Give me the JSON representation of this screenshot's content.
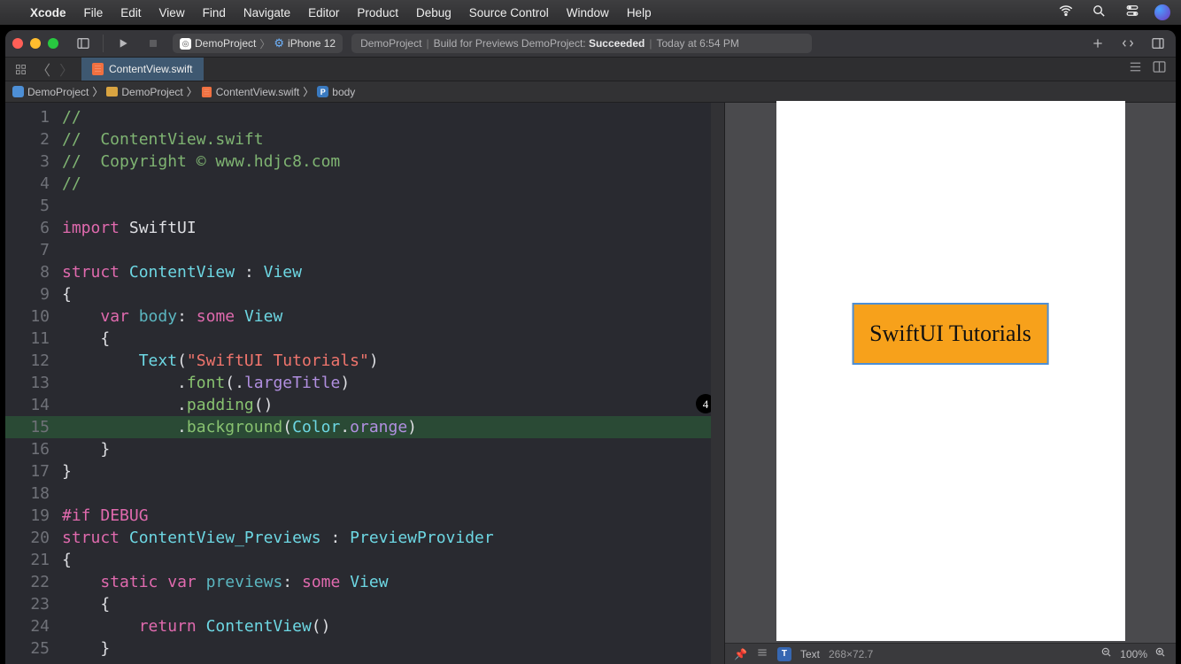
{
  "menubar": {
    "app": "Xcode",
    "items": [
      "File",
      "Edit",
      "View",
      "Find",
      "Navigate",
      "Editor",
      "Product",
      "Debug",
      "Source Control",
      "Window",
      "Help"
    ]
  },
  "toolbar": {
    "scheme_project": "DemoProject",
    "scheme_device": "iPhone 12",
    "activity_prefix": "DemoProject",
    "activity_mid": "Build for Previews DemoProject:",
    "activity_status": "Succeeded",
    "activity_time": "Today at 6:54 PM"
  },
  "tab": {
    "filename": "ContentView.swift"
  },
  "breadcrumbs": [
    {
      "icon": "proj",
      "label": "DemoProject"
    },
    {
      "icon": "fold",
      "label": "DemoProject"
    },
    {
      "icon": "file",
      "label": "ContentView.swift"
    },
    {
      "icon": "prop",
      "label": "body"
    }
  ],
  "code": {
    "lines": [
      {
        "n": 1,
        "html": "<span class='tok-comment'>//</span>"
      },
      {
        "n": 2,
        "html": "<span class='tok-comment'>//  ContentView.swift</span>"
      },
      {
        "n": 3,
        "html": "<span class='tok-comment'>//  Copyright © www.hdjc8.com</span>"
      },
      {
        "n": 4,
        "html": "<span class='tok-comment'>//</span>"
      },
      {
        "n": 5,
        "html": ""
      },
      {
        "n": 6,
        "html": "<span class='tok-keyword'>import</span> <span class='tok-text'>SwiftUI</span>"
      },
      {
        "n": 7,
        "html": ""
      },
      {
        "n": 8,
        "html": "<span class='tok-keyword'>struct</span> <span class='tok-type'>ContentView</span> <span class='tok-text'>:</span> <span class='tok-type'>View</span>"
      },
      {
        "n": 9,
        "html": "<span class='tok-text'>{</span>"
      },
      {
        "n": 10,
        "html": "    <span class='tok-keyword'>var</span> <span class='tok-typealt'>body</span><span class='tok-text'>:</span> <span class='tok-keyword'>some</span> <span class='tok-type'>View</span>"
      },
      {
        "n": 11,
        "html": "    <span class='tok-text'>{</span>"
      },
      {
        "n": 12,
        "html": "        <span class='tok-type'>Text</span><span class='tok-text'>(</span><span class='tok-string'>\"SwiftUI Tutorials\"</span><span class='tok-text'>)</span>"
      },
      {
        "n": 13,
        "html": "            <span class='tok-text'>.</span><span class='tok-func'>font</span><span class='tok-text'>(.</span><span class='tok-enum'>largeTitle</span><span class='tok-text'>)</span>"
      },
      {
        "n": 14,
        "html": "            <span class='tok-text'>.</span><span class='tok-func'>padding</span><span class='tok-text'>()</span>",
        "badge": "4"
      },
      {
        "n": 15,
        "html": "            <span class='tok-text'>.</span><span class='tok-func'>background</span><span class='tok-text'>(</span><span class='tok-type'>Color</span><span class='tok-text'>.</span><span class='tok-enum'>orange</span><span class='tok-text'>)</span>",
        "hl": true
      },
      {
        "n": 16,
        "html": "    <span class='tok-text'>}</span>"
      },
      {
        "n": 17,
        "html": "<span class='tok-text'>}</span>"
      },
      {
        "n": 18,
        "html": ""
      },
      {
        "n": 19,
        "html": "<span class='tok-keyword'>#if</span> <span class='tok-keyword'>DEBUG</span>"
      },
      {
        "n": 20,
        "html": "<span class='tok-keyword'>struct</span> <span class='tok-type'>ContentView_Previews</span> <span class='tok-text'>:</span> <span class='tok-type'>PreviewProvider</span>"
      },
      {
        "n": 21,
        "html": "<span class='tok-text'>{</span>"
      },
      {
        "n": 22,
        "html": "    <span class='tok-keyword'>static</span> <span class='tok-keyword'>var</span> <span class='tok-typealt'>previews</span><span class='tok-text'>:</span> <span class='tok-keyword'>some</span> <span class='tok-type'>View</span>"
      },
      {
        "n": 23,
        "html": "    <span class='tok-text'>{</span>"
      },
      {
        "n": 24,
        "html": "        <span class='tok-keyword'>return</span> <span class='tok-type'>ContentView</span><span class='tok-text'>()</span>"
      },
      {
        "n": 25,
        "html": "    <span class='tok-text'>}</span>"
      }
    ]
  },
  "preview": {
    "text": "SwiftUI Tutorials"
  },
  "canvas_status": {
    "element": "Text",
    "dims": "268×72.7",
    "zoom": "100%"
  }
}
